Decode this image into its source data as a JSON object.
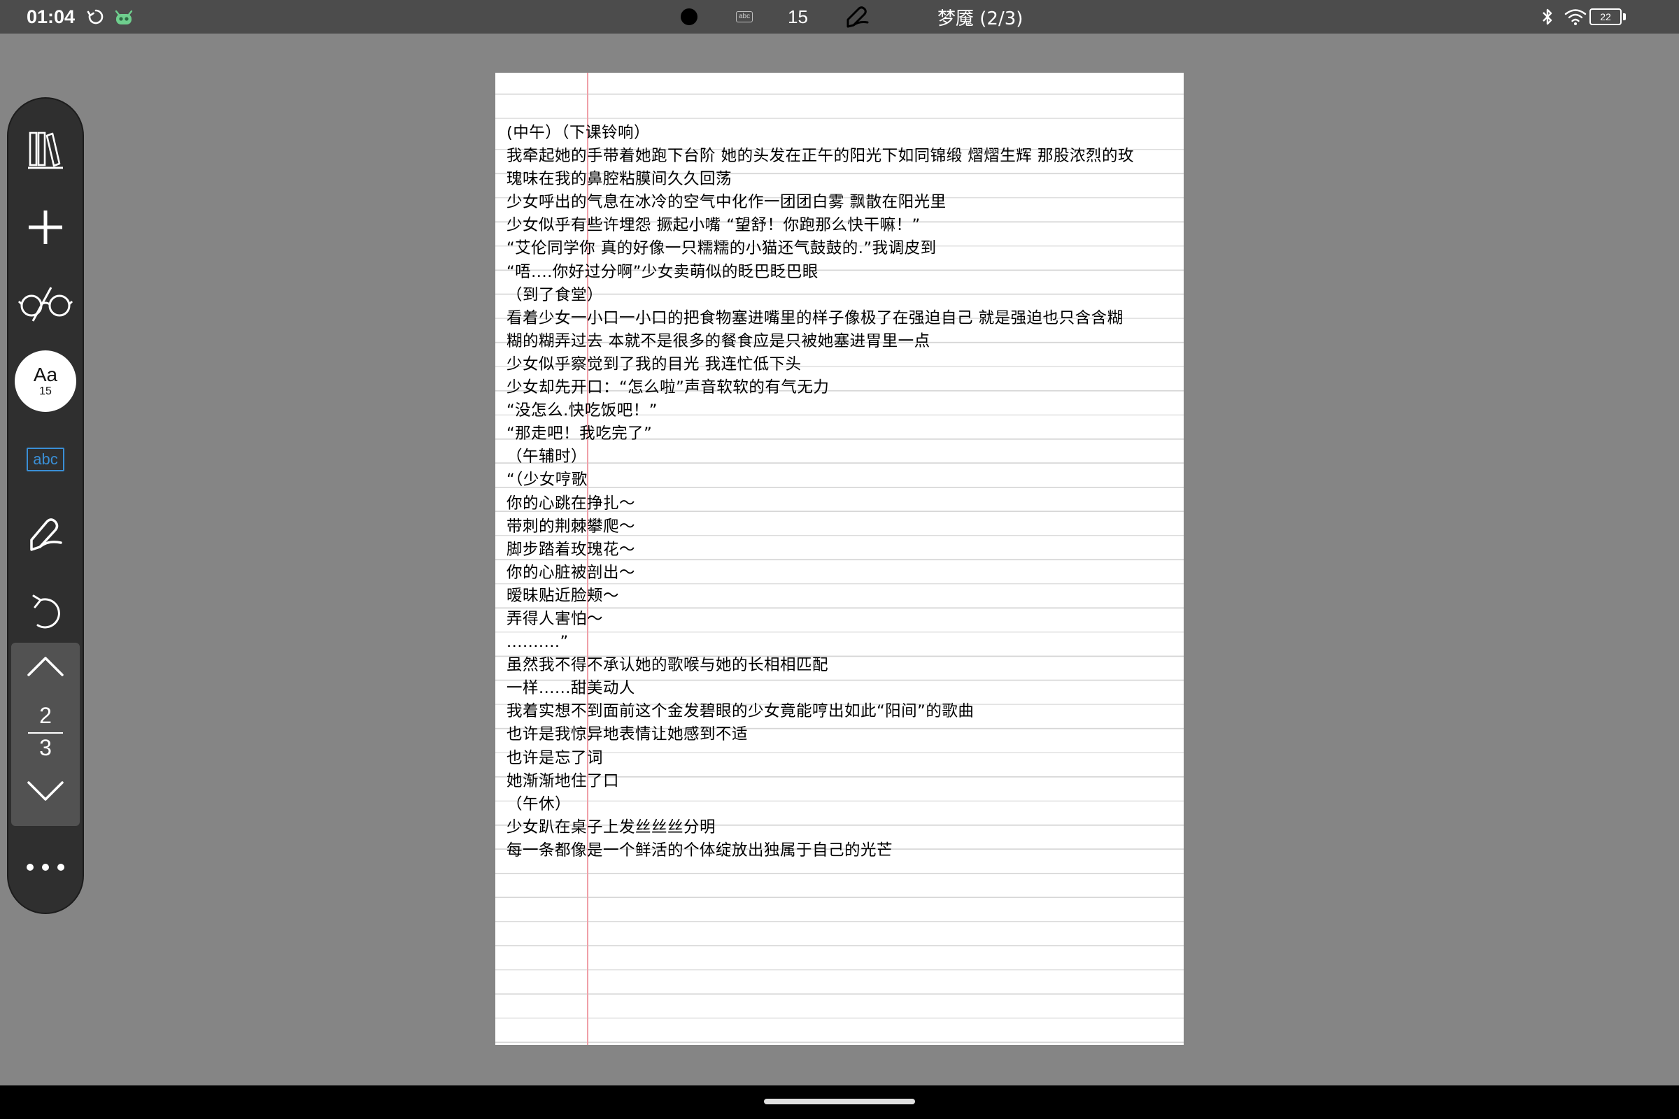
{
  "status_bar": {
    "time": "01:04",
    "font_size": "15",
    "doc_title": "梦魇 (2/3)",
    "battery": "22",
    "icons": [
      "sync-icon",
      "robot-icon",
      "record-dot-icon",
      "abc-icon",
      "pen-icon",
      "bluetooth-icon",
      "wifi-icon",
      "battery-icon"
    ]
  },
  "toolbar": {
    "font_button": {
      "label": "Aa",
      "size": "15"
    },
    "abc_label": "abc",
    "pager": {
      "current": "2",
      "total": "3"
    },
    "icons": [
      "library-icon",
      "add-icon",
      "glasses-icon",
      "pen-icon",
      "undo-icon",
      "chevron-up-icon",
      "chevron-down-icon",
      "more-icon"
    ]
  },
  "document": {
    "lines": [
      "(中午）（下课铃响）",
      "我牵起她的手带着她跑下台阶  她的头发在正午的阳光下如同锦缎 熠熠生辉 那股浓烈的玫",
      "瑰味在我的鼻腔粘膜间久久回荡",
      "少女呼出的气息在冰冷的空气中化作一团团白雾 飘散在阳光里",
      "少女似乎有些许埋怨 撅起小嘴 “望舒！你跑那么快干嘛！”",
      "“艾伦同学你 真的好像一只糯糯的小猫还气鼓鼓的.”我调皮到",
      "“唔....你好过分啊”少女卖萌似的眨巴眨巴眼",
      "（到了食堂）",
      "看着少女一小口一小口的把食物塞进嘴里的样子像极了在强迫自己   就是强迫也只含含糊",
      "糊的糊弄过去  本就不是很多的餐食应是只被她塞进胃里一点",
      "少女似乎察觉到了我的目光 我连忙低下头",
      "少女却先开口：“怎么啦”声音软软的有气无力",
      "“没怎么.快吃饭吧！”",
      "“那走吧！我吃完了”",
      "（午辅时）",
      "“（少女哼歌",
      "你的心跳在挣扎～",
      "带刺的荆棘攀爬～",
      "脚步踏着玫瑰花～",
      "你的心脏被剖出～",
      "暧昧贴近脸颊～",
      "弄得人害怕～",
      "..........”",
      "虽然我不得不承认她的歌喉与她的长相相匹配",
      "一样......甜美动人",
      "我着实想不到面前这个金发碧眼的少女竟能哼出如此“阳间”的歌曲",
      "也许是我惊异地表情让她感到不适",
      "也许是忘了词",
      "她渐渐地住了口",
      "（午休）",
      "少女趴在桌子上发丝丝丝分明",
      "每一条都像是一个鲜活的个体绽放出独属于自己的光芒"
    ]
  },
  "nav_bar": {
    "icons": [
      "home-indicator"
    ]
  }
}
